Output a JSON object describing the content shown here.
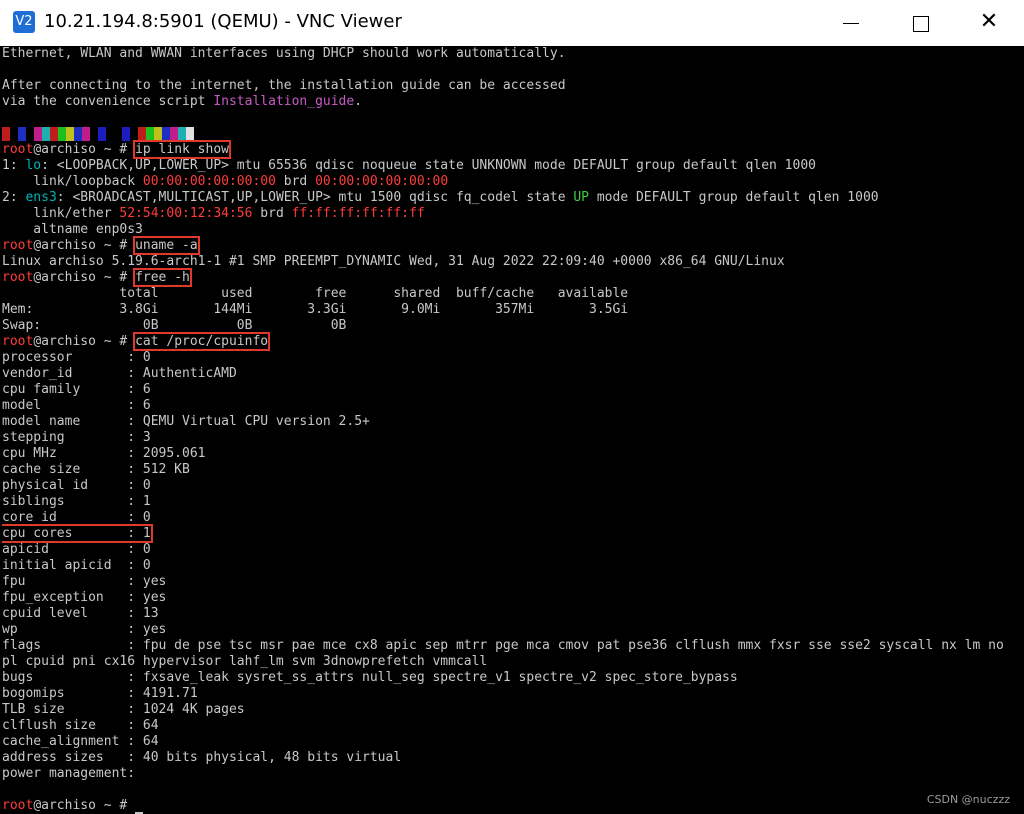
{
  "window": {
    "title": "10.21.194.8:5901 (QEMU) - VNC Viewer",
    "app_icon": "V2",
    "min_label": "",
    "max_label": "",
    "close_label": "✕"
  },
  "terminal": {
    "lines": [
      "Ethernet, WLAN and WWAN interfaces using DHCP should work automatically.",
      "",
      "After connecting to the internet, the installation guide can be accessed",
      "via the convenience script Installation_guide.",
      "",
      "[color-blocks]",
      "root@archiso ~ # ip link show",
      "1: lo: <LOOPBACK,UP,LOWER_UP> mtu 65536 qdisc noqueue state UNKNOWN mode DEFAULT group default qlen 1000",
      "    link/loopback 00:00:00:00:00:00 brd 00:00:00:00:00:00",
      "2: ens3: <BROADCAST,MULTICAST,UP,LOWER_UP> mtu 1500 qdisc fq_codel state UP mode DEFAULT group default qlen 1000",
      "    link/ether 52:54:00:12:34:56 brd ff:ff:ff:ff:ff:ff",
      "    altname enp0s3",
      "root@archiso ~ # uname -a",
      "Linux archiso 5.19.6-arch1-1 #1 SMP PREEMPT_DYNAMIC Wed, 31 Aug 2022 22:09:40 +0000 x86_64 GNU/Linux",
      "root@archiso ~ # free -h",
      "               total        used        free      shared  buff/cache   available",
      "Mem:           3.8Gi       144Mi       3.3Gi       9.0Mi       357Mi       3.5Gi",
      "Swap:             0B          0B          0B",
      "root@archiso ~ # cat /proc/cpuinfo",
      "processor       : 0",
      "vendor_id       : AuthenticAMD",
      "cpu family      : 6",
      "model           : 6",
      "model name      : QEMU Virtual CPU version 2.5+",
      "stepping        : 3",
      "cpu MHz         : 2095.061",
      "cache size      : 512 KB",
      "physical id     : 0",
      "siblings        : 1",
      "core id         : 0",
      "cpu cores       : 1",
      "apicid          : 0",
      "initial apicid  : 0",
      "fpu             : yes",
      "fpu_exception   : yes",
      "cpuid level     : 13",
      "wp              : yes",
      "flags           : fpu de pse tsc msr pae mce cx8 apic sep mtrr pge mca cmov pat pse36 clflush mmx fxsr sse sse2 syscall nx lm no",
      "pl cpuid pni cx16 hypervisor lahf_lm svm 3dnowprefetch vmmcall",
      "bugs            : fxsave_leak sysret_ss_attrs null_seg spectre_v1 spectre_v2 spec_store_bypass",
      "bogomips        : 4191.71",
      "TLB size        : 1024 4K pages",
      "clflush size    : 64",
      "cache_alignment : 64",
      "address sizes   : 40 bits physical, 48 bits virtual",
      "power management:",
      "",
      "root@archiso ~ # "
    ],
    "prompt_user": "root",
    "prompt_rest": "@archiso ~ # ",
    "link_text": "Installation_guide",
    "color_blocks": [
      "#c01c1c",
      "#000000",
      "#1c2fc0",
      "#000000",
      "#c01c8c",
      "#1cb0b0",
      "#c01c1c",
      "#1cc01c",
      "#c0c01c",
      "#1c2fc0",
      "#c01c8c",
      "#000000",
      "#1c1cc0",
      "#000000",
      "#000000",
      "#1c1cc0",
      "#000000",
      "#c01c1c",
      "#1cc01c",
      "#c0c01c",
      "#1c2fc0",
      "#c01c8c",
      "#1cb0b0",
      "#e0e0e0"
    ]
  },
  "watermark": "CSDN @nuczzz"
}
